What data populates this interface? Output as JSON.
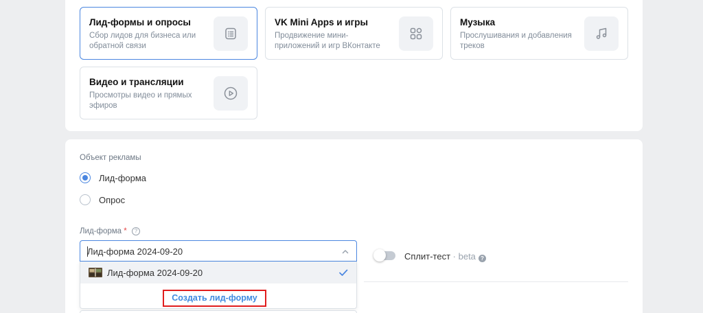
{
  "cards": [
    {
      "title": "Лид-формы и опросы",
      "desc": "Сбор лидов для бизнеса или обратной связи",
      "icon": "form-icon",
      "selected": true
    },
    {
      "title": "VK Mini Apps и игры",
      "desc": "Продвижение мини-приложений и игр ВКонтакте",
      "icon": "apps-grid-icon",
      "selected": false
    },
    {
      "title": "Музыка",
      "desc": "Прослушивания и добавления треков",
      "icon": "music-note-icon",
      "selected": false
    },
    {
      "title": "Видео и трансляции",
      "desc": "Просмотры видео и прямых эфиров",
      "icon": "play-icon",
      "selected": false
    }
  ],
  "ad_object": {
    "label": "Объект рекламы",
    "options": [
      {
        "label": "Лид-форма",
        "checked": true
      },
      {
        "label": "Опрос",
        "checked": false
      }
    ]
  },
  "lead_form": {
    "label": "Лид-форма",
    "required_mark": "*",
    "help": "?",
    "value": "Лид-форма 2024-09-20",
    "options": [
      {
        "label": "Лид-форма 2024-09-20",
        "selected": true
      }
    ],
    "create_label": "Создать лид-форму"
  },
  "split_test": {
    "label": "Сплит-тест",
    "beta": " · beta",
    "enabled": false
  },
  "colors": {
    "accent": "#4a86e0",
    "link": "#3f8ae0",
    "highlight_border": "#e01c1c"
  }
}
